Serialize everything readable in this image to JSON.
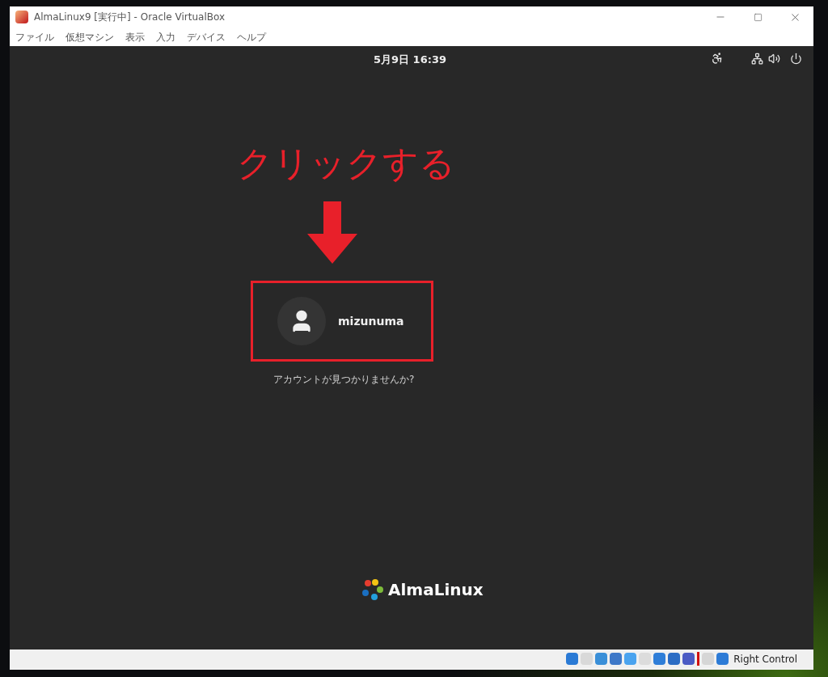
{
  "window": {
    "title": "AlmaLinux9 [実行中] - Oracle VirtualBox"
  },
  "menu": [
    "ファイル",
    "仮想マシン",
    "表示",
    "入力",
    "デバイス",
    "ヘルプ"
  ],
  "top_bar": {
    "clock": "5月9日  16:39"
  },
  "annotation": {
    "text": "クリックする"
  },
  "user": {
    "name": "mizunuma"
  },
  "not_listed_link": "アカウントが見つかりませんか?",
  "logo": {
    "text": "AlmaLinux"
  },
  "status_bar": {
    "host_key": "Right Control"
  }
}
